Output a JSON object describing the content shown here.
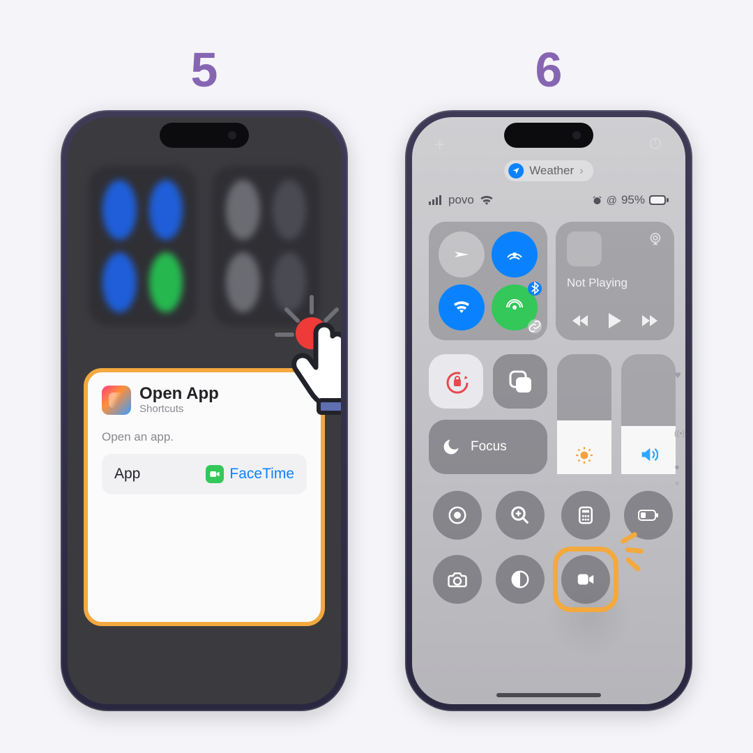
{
  "steps": {
    "left": "5",
    "right": "6"
  },
  "phone5": {
    "popup": {
      "title": "Open App",
      "subtitle": "Shortcuts",
      "description": "Open an app.",
      "row_label": "App",
      "row_value": "FaceTime"
    }
  },
  "phone6": {
    "weather_label": "Weather",
    "carrier": "povo",
    "battery_pct": "95%",
    "now_playing": "Not Playing",
    "focus_label": "Focus"
  },
  "colors": {
    "accent": "#f3a93e",
    "step_number": "#8666b3",
    "ios_blue": "#0a82ff",
    "ios_green": "#34c759"
  }
}
